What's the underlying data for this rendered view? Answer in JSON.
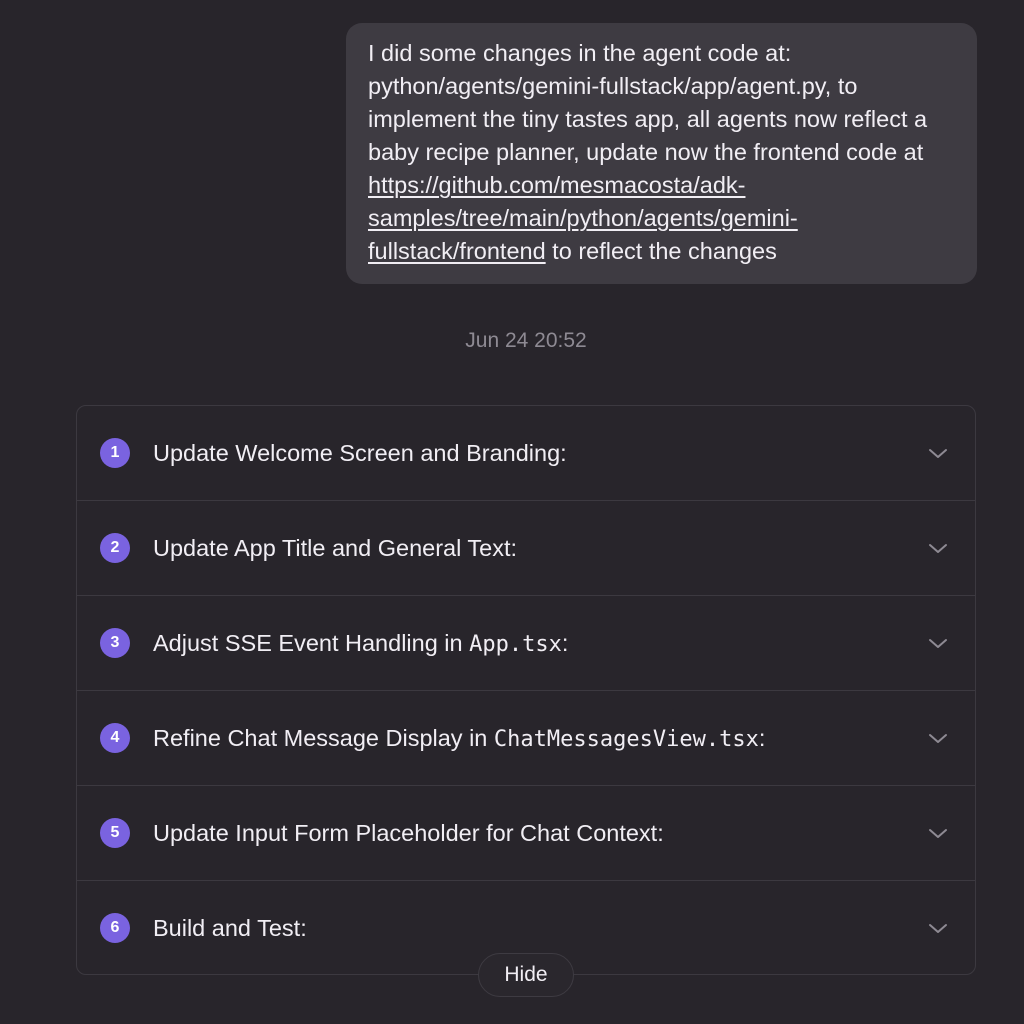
{
  "user_message": {
    "text_before_link": "I did some changes in the agent code at: python/agents/gemini-fullstack/app/agent.py, to implement the tiny tastes app, all agents now reflect a baby recipe planner, update now the frontend code at ",
    "link_text": "https://github.com/mesmacosta/adk-samples/tree/main/python/agents/gemini-fullstack/frontend",
    "text_after_link": " to reflect the changes"
  },
  "timestamp": "Jun 24 20:52",
  "plan": {
    "steps": [
      {
        "number": "1",
        "title": "Update Welcome Screen and Branding:",
        "code": "",
        "suffix": ""
      },
      {
        "number": "2",
        "title": "Update App Title and General Text:",
        "code": "",
        "suffix": ""
      },
      {
        "number": "3",
        "title": "Adjust SSE Event Handling in ",
        "code": "App.tsx",
        "suffix": ":"
      },
      {
        "number": "4",
        "title": "Refine Chat Message Display in ",
        "code": "ChatMessagesView.tsx",
        "suffix": ":"
      },
      {
        "number": "5",
        "title": "Update Input Form Placeholder for Chat Context:",
        "code": "",
        "suffix": ""
      },
      {
        "number": "6",
        "title": "Build and Test:",
        "code": "",
        "suffix": ""
      }
    ]
  },
  "hide_button_label": "Hide",
  "icons": {
    "step_toggle": "chevron-down-icon"
  },
  "colors": {
    "background": "#28252b",
    "bubble": "#3e3b42",
    "accent": "#7a63e0",
    "muted_text": "#8e8a93"
  }
}
